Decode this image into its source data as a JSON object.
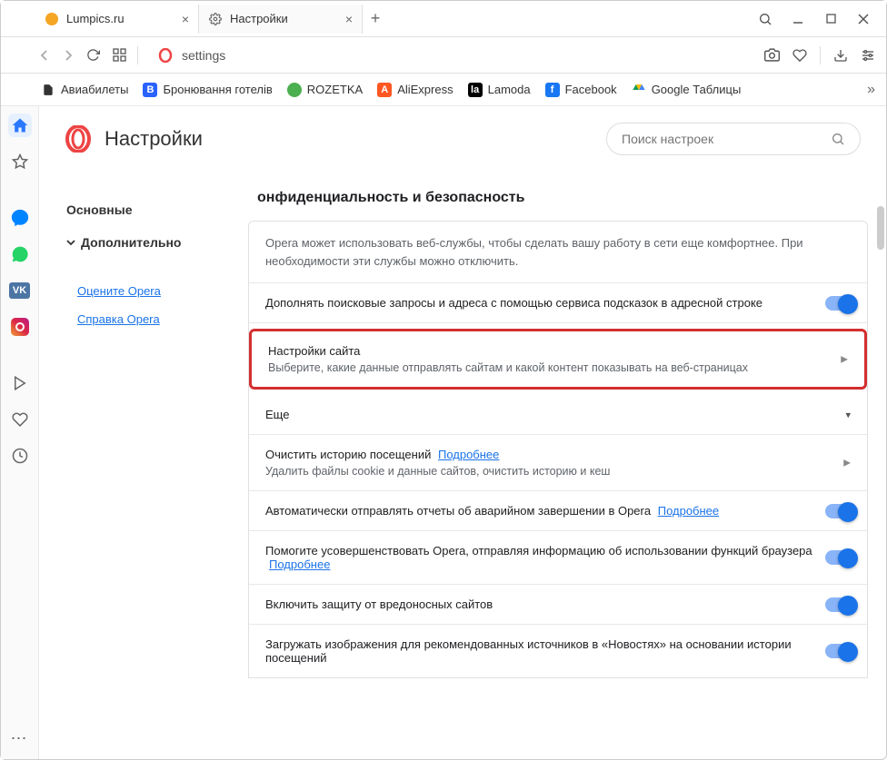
{
  "tabs": [
    {
      "title": "Lumpics.ru",
      "favicon_color": "#f5a623"
    },
    {
      "title": "Настройки",
      "favicon": "gear"
    }
  ],
  "address": {
    "text": "settings"
  },
  "window_controls": {
    "search": "⌕"
  },
  "bookmarks": [
    {
      "icon": "📄",
      "icon_bg": "transparent",
      "label": "Авиабилеты"
    },
    {
      "icon": "B",
      "icon_bg": "#2962ff",
      "label": "Бронювання готелів"
    },
    {
      "icon": "●",
      "icon_bg": "#4caf50",
      "label": "ROZETKA"
    },
    {
      "icon": "A",
      "icon_bg": "#ff5722",
      "label": "AliExpress"
    },
    {
      "icon": "la",
      "icon_bg": "#000",
      "label": "Lamoda"
    },
    {
      "icon": "f",
      "icon_bg": "#1877f2",
      "label": "Facebook"
    },
    {
      "icon": "▲",
      "icon_bg": "#fff",
      "label": "Google Таблицы"
    }
  ],
  "settings": {
    "title": "Настройки",
    "search_placeholder": "Поиск настроек",
    "nav": {
      "basic": "Основные",
      "advanced": "Дополнительно",
      "rate": "Оцените Opera",
      "help": "Справка Opera"
    },
    "section_title": "онфиденциальность и безопасность",
    "intro": "Opera может использовать веб-службы, чтобы сделать вашу работу в сети еще комфортнее. При необходимости эти службы можно отключить.",
    "rows": {
      "autocomplete": "Дополнять поисковые запросы и адреса с помощью сервиса подсказок в адресной строке",
      "site_settings_title": "Настройки сайта",
      "site_settings_sub": "Выберите, какие данные отправлять сайтам и какой контент показывать на веб-страницах",
      "more": "Еще",
      "clear_history_title": "Очистить историю посещений",
      "clear_history_link": "Подробнее",
      "clear_history_sub": "Удалить файлы cookie и данные сайтов, очистить историю и кеш",
      "crash_reports": "Автоматически отправлять отчеты об аварийном завершении в Opera",
      "crash_link": "Подробнее",
      "improve": "Помогите усовершенствовать Opera, отправляя информацию об использовании функций браузера",
      "improve_link": "Подробнее",
      "malware": "Включить защиту от вредоносных сайтов",
      "news_images": "Загружать изображения для рекомендованных источников в «Новостях» на основании истории посещений"
    }
  }
}
